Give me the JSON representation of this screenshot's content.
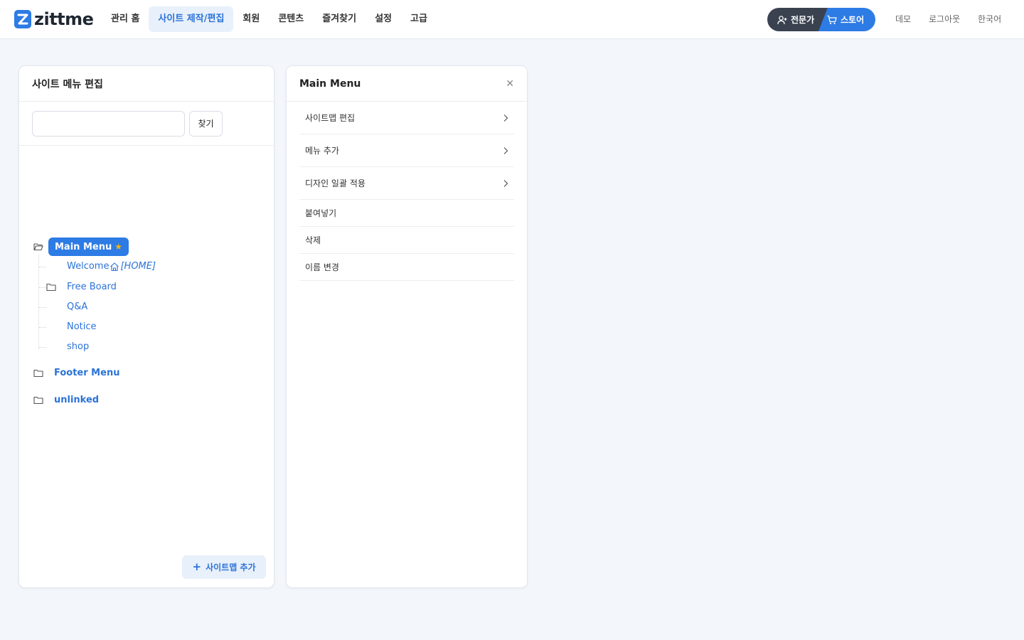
{
  "brand": {
    "name": "zittme",
    "accent": "#2d7be5",
    "dark": "#3a4250"
  },
  "nav": {
    "items": [
      {
        "label": "관리 홈"
      },
      {
        "label": "사이트 제작/편집",
        "active": true
      },
      {
        "label": "회원"
      },
      {
        "label": "콘텐츠"
      },
      {
        "label": "즐겨찾기"
      },
      {
        "label": "설정"
      },
      {
        "label": "고급"
      }
    ]
  },
  "pill": {
    "expert_label": "전문가",
    "store_label": "스토어",
    "expert_icon": "user-plus-icon",
    "store_icon": "cart-icon"
  },
  "utility": {
    "demo": "데모",
    "logout": "로그아웃",
    "language": "한국어"
  },
  "left_panel": {
    "title": "사이트 메뉴 편집",
    "search": {
      "value": "",
      "placeholder": "",
      "button": "찾기"
    },
    "tree": {
      "main_menu": {
        "label": "Main Menu",
        "starred": true
      },
      "children": [
        {
          "label": "Welcome",
          "home_tag": "[HOME]",
          "icon": "home-icon"
        },
        {
          "label": "Free Board",
          "icon": "folder-icon"
        },
        {
          "label": "Q&A"
        },
        {
          "label": "Notice"
        },
        {
          "label": "shop"
        }
      ],
      "footer_menu": "Footer Menu",
      "unlinked": "unlinked"
    },
    "add_button": "사이트맵 추가"
  },
  "right_panel": {
    "title": "Main Menu",
    "items": [
      {
        "label": "사이트맵 편집",
        "has_arrow": true
      },
      {
        "label": "메뉴 추가",
        "has_arrow": true
      },
      {
        "label": "디자인 일괄 적용",
        "has_arrow": true
      },
      {
        "label": "붙여넣기",
        "has_arrow": false
      },
      {
        "label": "삭제",
        "has_arrow": false
      },
      {
        "label": "이름 변경",
        "has_arrow": false
      }
    ]
  }
}
